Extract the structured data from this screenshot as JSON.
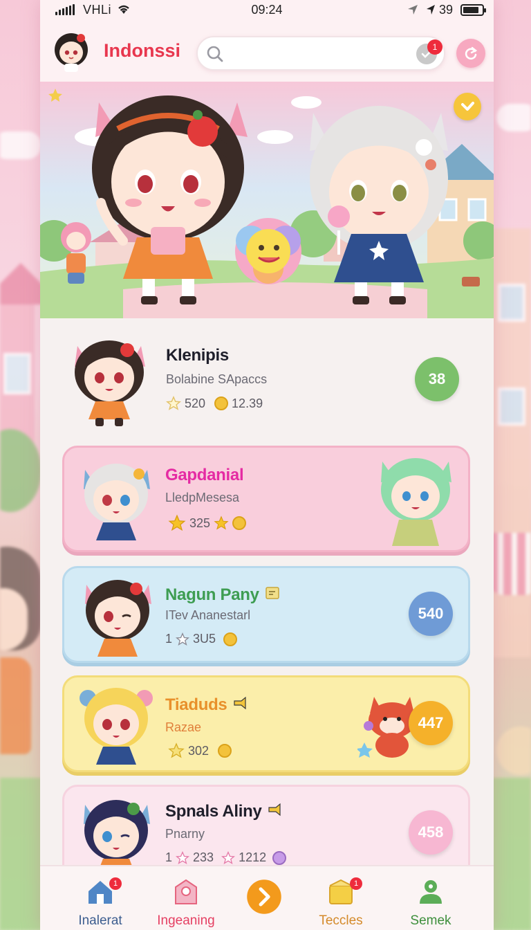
{
  "status_bar": {
    "carrier": "VHLi",
    "time": "09:24",
    "right_text": "39",
    "battery_level": 0.85
  },
  "header": {
    "title": "Indonssi",
    "search": {
      "placeholder": "",
      "value": ""
    },
    "notification_count": "1"
  },
  "hero": {
    "badge_icon": "check-badge-icon"
  },
  "cards": [
    {
      "name": "Klenipis",
      "subtitle": "Bolabine SApaccs",
      "stat1": "520",
      "stat2": "12.39",
      "score": "38",
      "accent": "#7cc06b",
      "name_color": "#1f1f2b",
      "bg": "#f6f1f0"
    },
    {
      "name": "Gapdanial",
      "subtitle": "LledpMesesa",
      "stat1": "325",
      "stat2": "",
      "score": "",
      "accent": "#e52ba3",
      "name_color": "#e52ba3",
      "bg": "#f9cedc"
    },
    {
      "name": "Nagun Pany",
      "subtitle": "ITev Ananestarl",
      "stat1": "1",
      "stat2": "3U5",
      "score": "540",
      "accent": "#6f9bd6",
      "name_color": "#3e9d52",
      "bg": "#d4ebf6"
    },
    {
      "name": "Tiaduds",
      "subtitle": "Razae",
      "stat1": "302",
      "stat2": "",
      "score": "447",
      "accent": "#f5b12a",
      "name_color": "#e8902b",
      "bg": "#fbeeaa"
    },
    {
      "name": "Spnals Aliny",
      "subtitle": "Pnarny",
      "stat1": "1",
      "stat2": "233",
      "stat3": "1212",
      "score": "458",
      "accent": "#f7b7d2",
      "name_color": "#1f1f2b",
      "bg": "#fbe6ee"
    }
  ],
  "bottom_nav": [
    {
      "label": "Inalerat",
      "color": "#3c5d8f",
      "icon": "house-icon",
      "badge": "1"
    },
    {
      "label": "Ingeaning",
      "color": "#e53f62",
      "icon": "tag-icon",
      "badge": ""
    },
    {
      "label": "",
      "color": "#f39a1c",
      "icon": "chevron-right-icon",
      "badge": ""
    },
    {
      "label": "Teccles",
      "color": "#d48a2a",
      "icon": "box-icon",
      "badge": "1"
    },
    {
      "label": "Semek",
      "color": "#3e8f3c",
      "icon": "person-icon",
      "badge": ""
    }
  ]
}
